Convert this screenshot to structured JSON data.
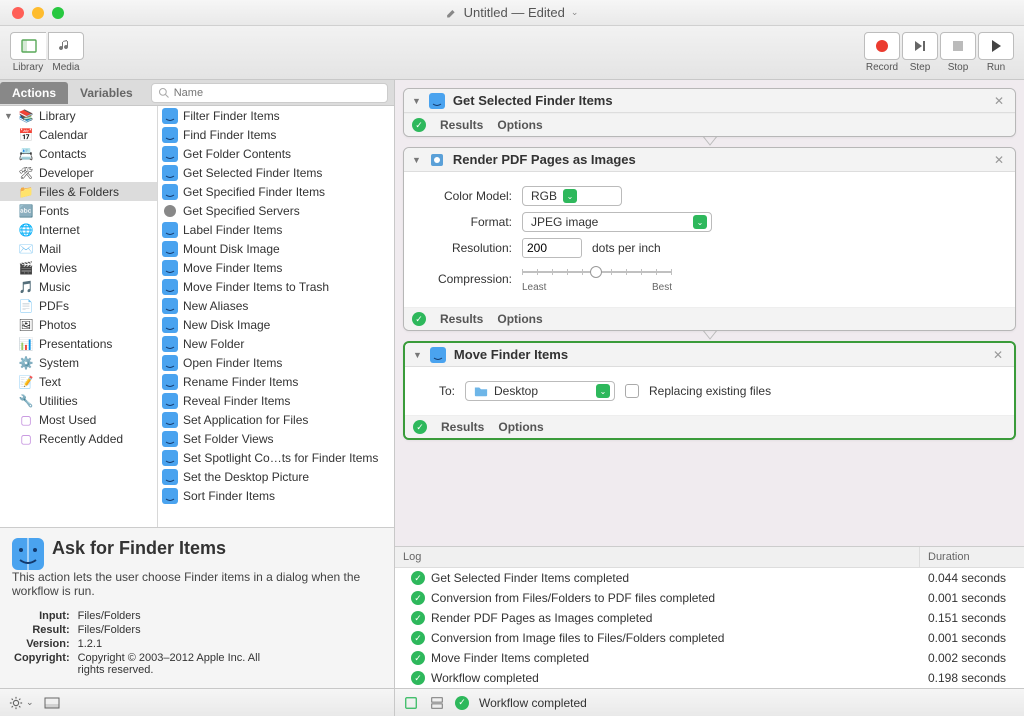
{
  "title": "Untitled — Edited",
  "toolbar": {
    "library": "Library",
    "media": "Media",
    "record": "Record",
    "step": "Step",
    "stop": "Stop",
    "run": "Run"
  },
  "tabs": {
    "actions": "Actions",
    "variables": "Variables",
    "search_ph": "Name"
  },
  "library": {
    "root": "Library",
    "items": [
      "Calendar",
      "Contacts",
      "Developer",
      "Files & Folders",
      "Fonts",
      "Internet",
      "Mail",
      "Movies",
      "Music",
      "PDFs",
      "Photos",
      "Presentations",
      "System",
      "Text",
      "Utilities"
    ],
    "extra": [
      "Most Used",
      "Recently Added"
    ],
    "selected": "Files & Folders"
  },
  "actions_list": [
    "Filter Finder Items",
    "Find Finder Items",
    "Get Folder Contents",
    "Get Selected Finder Items",
    "Get Specified Finder Items",
    "Get Specified Servers",
    "Label Finder Items",
    "Mount Disk Image",
    "Move Finder Items",
    "Move Finder Items to Trash",
    "New Aliases",
    "New Disk Image",
    "New Folder",
    "Open Finder Items",
    "Rename Finder Items",
    "Reveal Finder Items",
    "Set Application for Files",
    "Set Folder Views",
    "Set Spotlight Co…ts for Finder Items",
    "Set the Desktop Picture",
    "Sort Finder Items"
  ],
  "description": {
    "title": "Ask for Finder Items",
    "body": "This action lets the user choose Finder items in a dialog when the workflow is run.",
    "input_lbl": "Input:",
    "input_val": "Files/Folders",
    "result_lbl": "Result:",
    "result_val": "Files/Folders",
    "version_lbl": "Version:",
    "version_val": "1.2.1",
    "copyright_lbl": "Copyright:",
    "copyright_val": "Copyright © 2003–2012 Apple Inc.  All rights reserved."
  },
  "workflow": {
    "a1": {
      "title": "Get Selected Finder Items"
    },
    "a2": {
      "title": "Render PDF Pages as Images",
      "color_model_lbl": "Color Model:",
      "color_model": "RGB",
      "format_lbl": "Format:",
      "format": "JPEG image",
      "resolution_lbl": "Resolution:",
      "resolution": "200",
      "dpi": "dots per inch",
      "compression_lbl": "Compression:",
      "least": "Least",
      "best": "Best"
    },
    "a3": {
      "title": "Move Finder Items",
      "to_lbl": "To:",
      "to_val": "Desktop",
      "replace_lbl": "Replacing existing files"
    },
    "foot": {
      "results": "Results",
      "options": "Options"
    }
  },
  "log": {
    "h1": "Log",
    "h2": "Duration",
    "rows": [
      {
        "msg": "Get Selected Finder Items completed",
        "dur": "0.044 seconds"
      },
      {
        "msg": "Conversion from Files/Folders to PDF files completed",
        "dur": "0.001 seconds"
      },
      {
        "msg": "Render PDF Pages as Images completed",
        "dur": "0.151 seconds"
      },
      {
        "msg": "Conversion from Image files to Files/Folders completed",
        "dur": "0.001 seconds"
      },
      {
        "msg": "Move Finder Items completed",
        "dur": "0.002 seconds"
      },
      {
        "msg": "Workflow completed",
        "dur": "0.198 seconds"
      }
    ]
  },
  "status": {
    "msg": "Workflow completed"
  }
}
